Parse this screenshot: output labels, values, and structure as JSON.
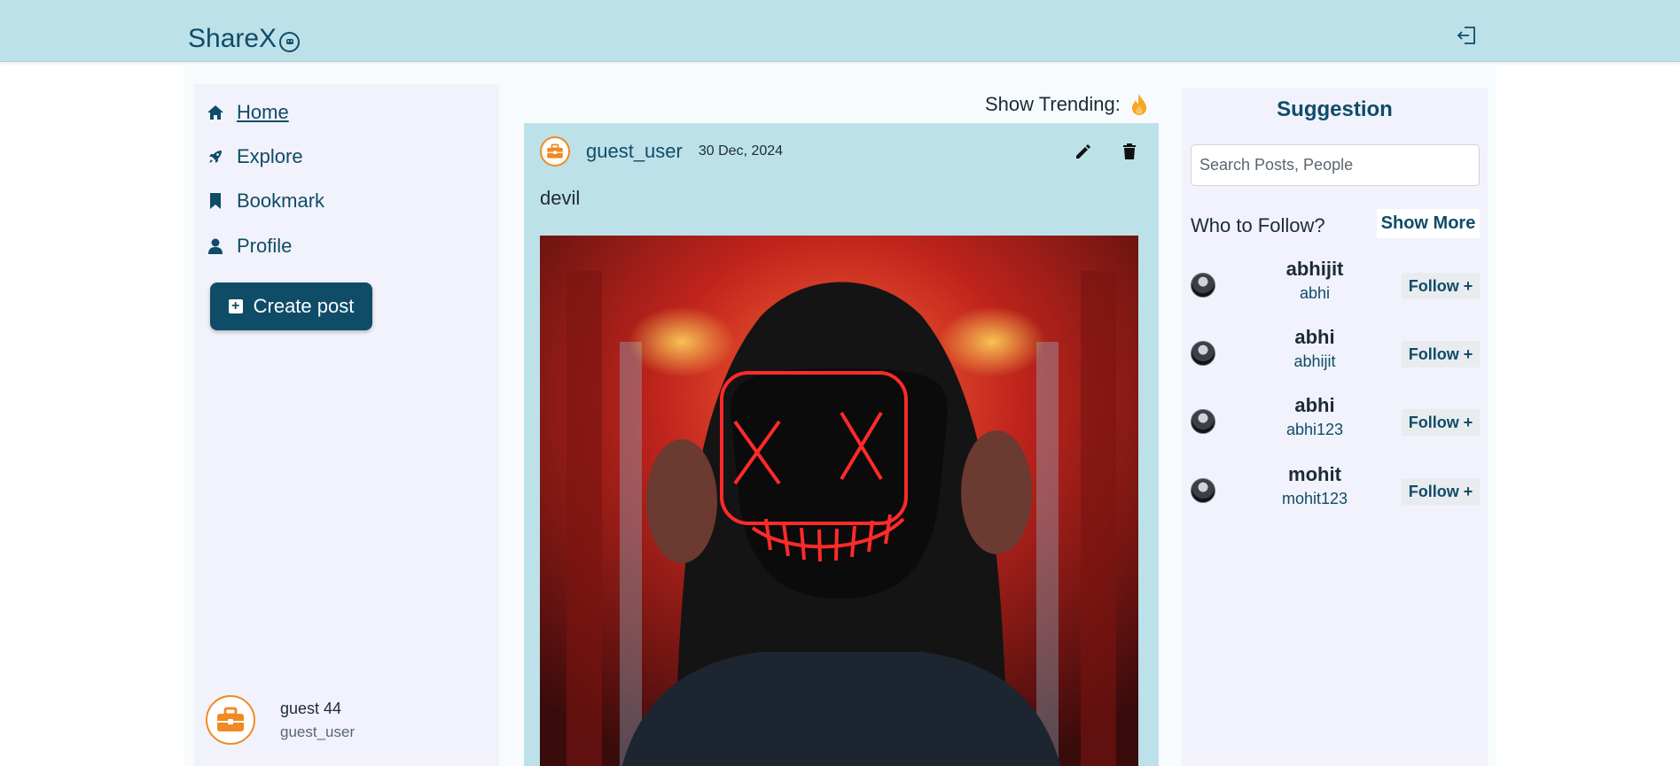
{
  "header": {
    "brand": "ShareX",
    "brand_icon": "smiley-icon",
    "logout_icon": "logout-icon"
  },
  "sidebar": {
    "items": [
      {
        "label": "Home",
        "icon": "home-icon",
        "active": true
      },
      {
        "label": "Explore",
        "icon": "rocket-icon",
        "active": false
      },
      {
        "label": "Bookmark",
        "icon": "bookmark-icon",
        "active": false
      },
      {
        "label": "Profile",
        "icon": "user-icon",
        "active": false
      }
    ],
    "create_post_label": "Create post",
    "current_user": {
      "name": "guest 44",
      "handle": "guest_user"
    }
  },
  "feed": {
    "trending_label": "Show Trending:",
    "post": {
      "author": "guest_user",
      "date": "30 Dec, 2024",
      "text": "devil"
    }
  },
  "suggestions": {
    "title": "Suggestion",
    "search_placeholder": "Search Posts, People",
    "who_to_follow": "Who to Follow?",
    "show_more": "Show More",
    "users": [
      {
        "name": "abhijit",
        "handle": "abhi",
        "follow_label": "Follow +"
      },
      {
        "name": "abhi",
        "handle": "abhijit",
        "follow_label": "Follow +"
      },
      {
        "name": "abhi",
        "handle": "abhi123",
        "follow_label": "Follow +"
      },
      {
        "name": "mohit",
        "handle": "mohit123",
        "follow_label": "Follow +"
      }
    ]
  },
  "colors": {
    "header_bg": "#bde1e9",
    "primary": "#0f4c68",
    "sidebar_bg": "#f1f2fb",
    "accent_orange": "#f08a24",
    "trending_flame": "#f5a623"
  }
}
